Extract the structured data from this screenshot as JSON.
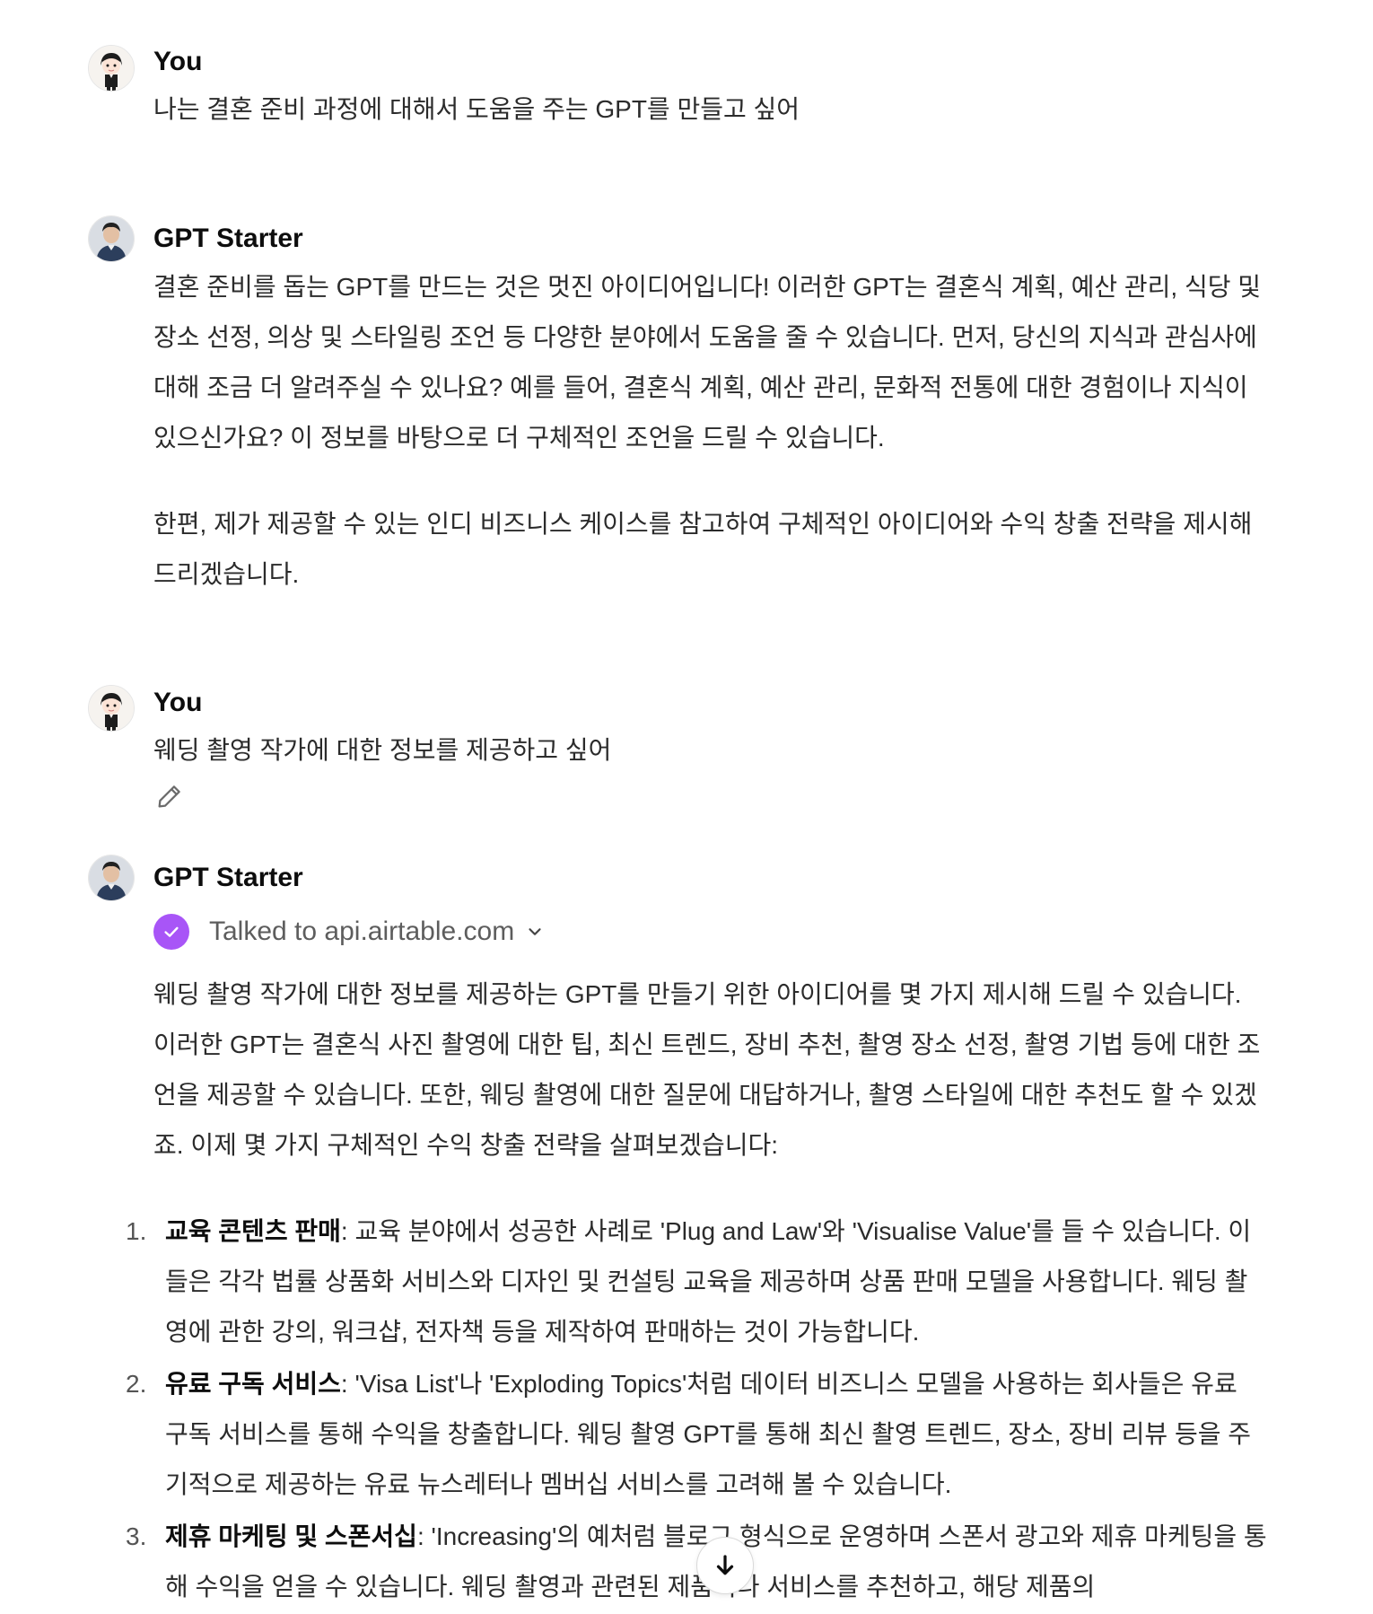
{
  "messages": [
    {
      "role": "user",
      "author": "You",
      "text": "나는 결혼 준비 과정에 대해서 도움을 주는 GPT를 만들고 싶어"
    },
    {
      "role": "assistant",
      "author": "GPT Starter",
      "paragraphs": [
        "결혼 준비를 돕는 GPT를 만드는 것은 멋진 아이디어입니다! 이러한 GPT는 결혼식 계획, 예산 관리, 식당 및 장소 선정, 의상 및 스타일링 조언 등 다양한 분야에서 도움을 줄 수 있습니다. 먼저, 당신의 지식과 관심사에 대해 조금 더 알려주실 수 있나요? 예를 들어, 결혼식 계획, 예산 관리, 문화적 전통에 대한 경험이나 지식이 있으신가요? 이 정보를 바탕으로 더 구체적인 조언을 드릴 수 있습니다.",
        "한편, 제가 제공할 수 있는 인디 비즈니스 케이스를 참고하여 구체적인 아이디어와 수익 창출 전략을 제시해 드리겠습니다."
      ]
    },
    {
      "role": "user",
      "author": "You",
      "text": "웨딩 촬영 작가에 대한 정보를 제공하고 싶어"
    },
    {
      "role": "assistant",
      "author": "GPT Starter",
      "tool_call": "Talked to api.airtable.com",
      "intro": "웨딩 촬영 작가에 대한 정보를 제공하는 GPT를 만들기 위한 아이디어를 몇 가지 제시해 드릴 수 있습니다. 이러한 GPT는 결혼식 사진 촬영에 대한 팁, 최신 트렌드, 장비 추천, 촬영 장소 선정, 촬영 기법 등에 대한 조언을 제공할 수 있습니다. 또한, 웨딩 촬영에 대한 질문에 대답하거나, 촬영 스타일에 대한 추천도 할 수 있겠죠. 이제 몇 가지 구체적인 수익 창출 전략을 살펴보겠습니다:",
      "list": [
        {
          "num": "1.",
          "title": "교육 콘텐츠 판매",
          "body": ": 교육 분야에서 성공한 사례로 'Plug and Law'와 'Visualise Value'를 들 수 있습니다. 이들은 각각 법률 상품화 서비스와 디자인 및 컨설팅 교육을 제공하며 상품 판매 모델을 사용합니다. 웨딩 촬영에 관한 강의, 워크샵, 전자책 등을 제작하여 판매하는 것이 가능합니다."
        },
        {
          "num": "2.",
          "title": "유료 구독 서비스",
          "body": ": 'Visa List'나 'Exploding Topics'처럼 데이터 비즈니스 모델을 사용하는 회사들은 유료 구독 서비스를 통해 수익을 창출합니다. 웨딩 촬영 GPT를 통해 최신 촬영 트렌드, 장소, 장비 리뷰 등을 주기적으로 제공하는 유료 뉴스레터나 멤버십 서비스를 고려해 볼 수 있습니다."
        },
        {
          "num": "3.",
          "title": "제휴 마케팅 및 스폰서십",
          "body": ": 'Increasing'의 예처럼 블로그 형식으로 운영하며 스폰서 광고와 제휴 마케팅을 통해 수익을 얻을 수 있습니다. 웨딩 촬영과 관련된 제품이나 서비스를 추천하고, 해당 제품의"
        }
      ]
    }
  ],
  "icons": {
    "edit": "pencil-icon",
    "tool_status": "check-icon",
    "expand": "chevron-down-icon",
    "scroll": "arrow-down-icon"
  },
  "colors": {
    "tool_check": "#a855f7"
  }
}
